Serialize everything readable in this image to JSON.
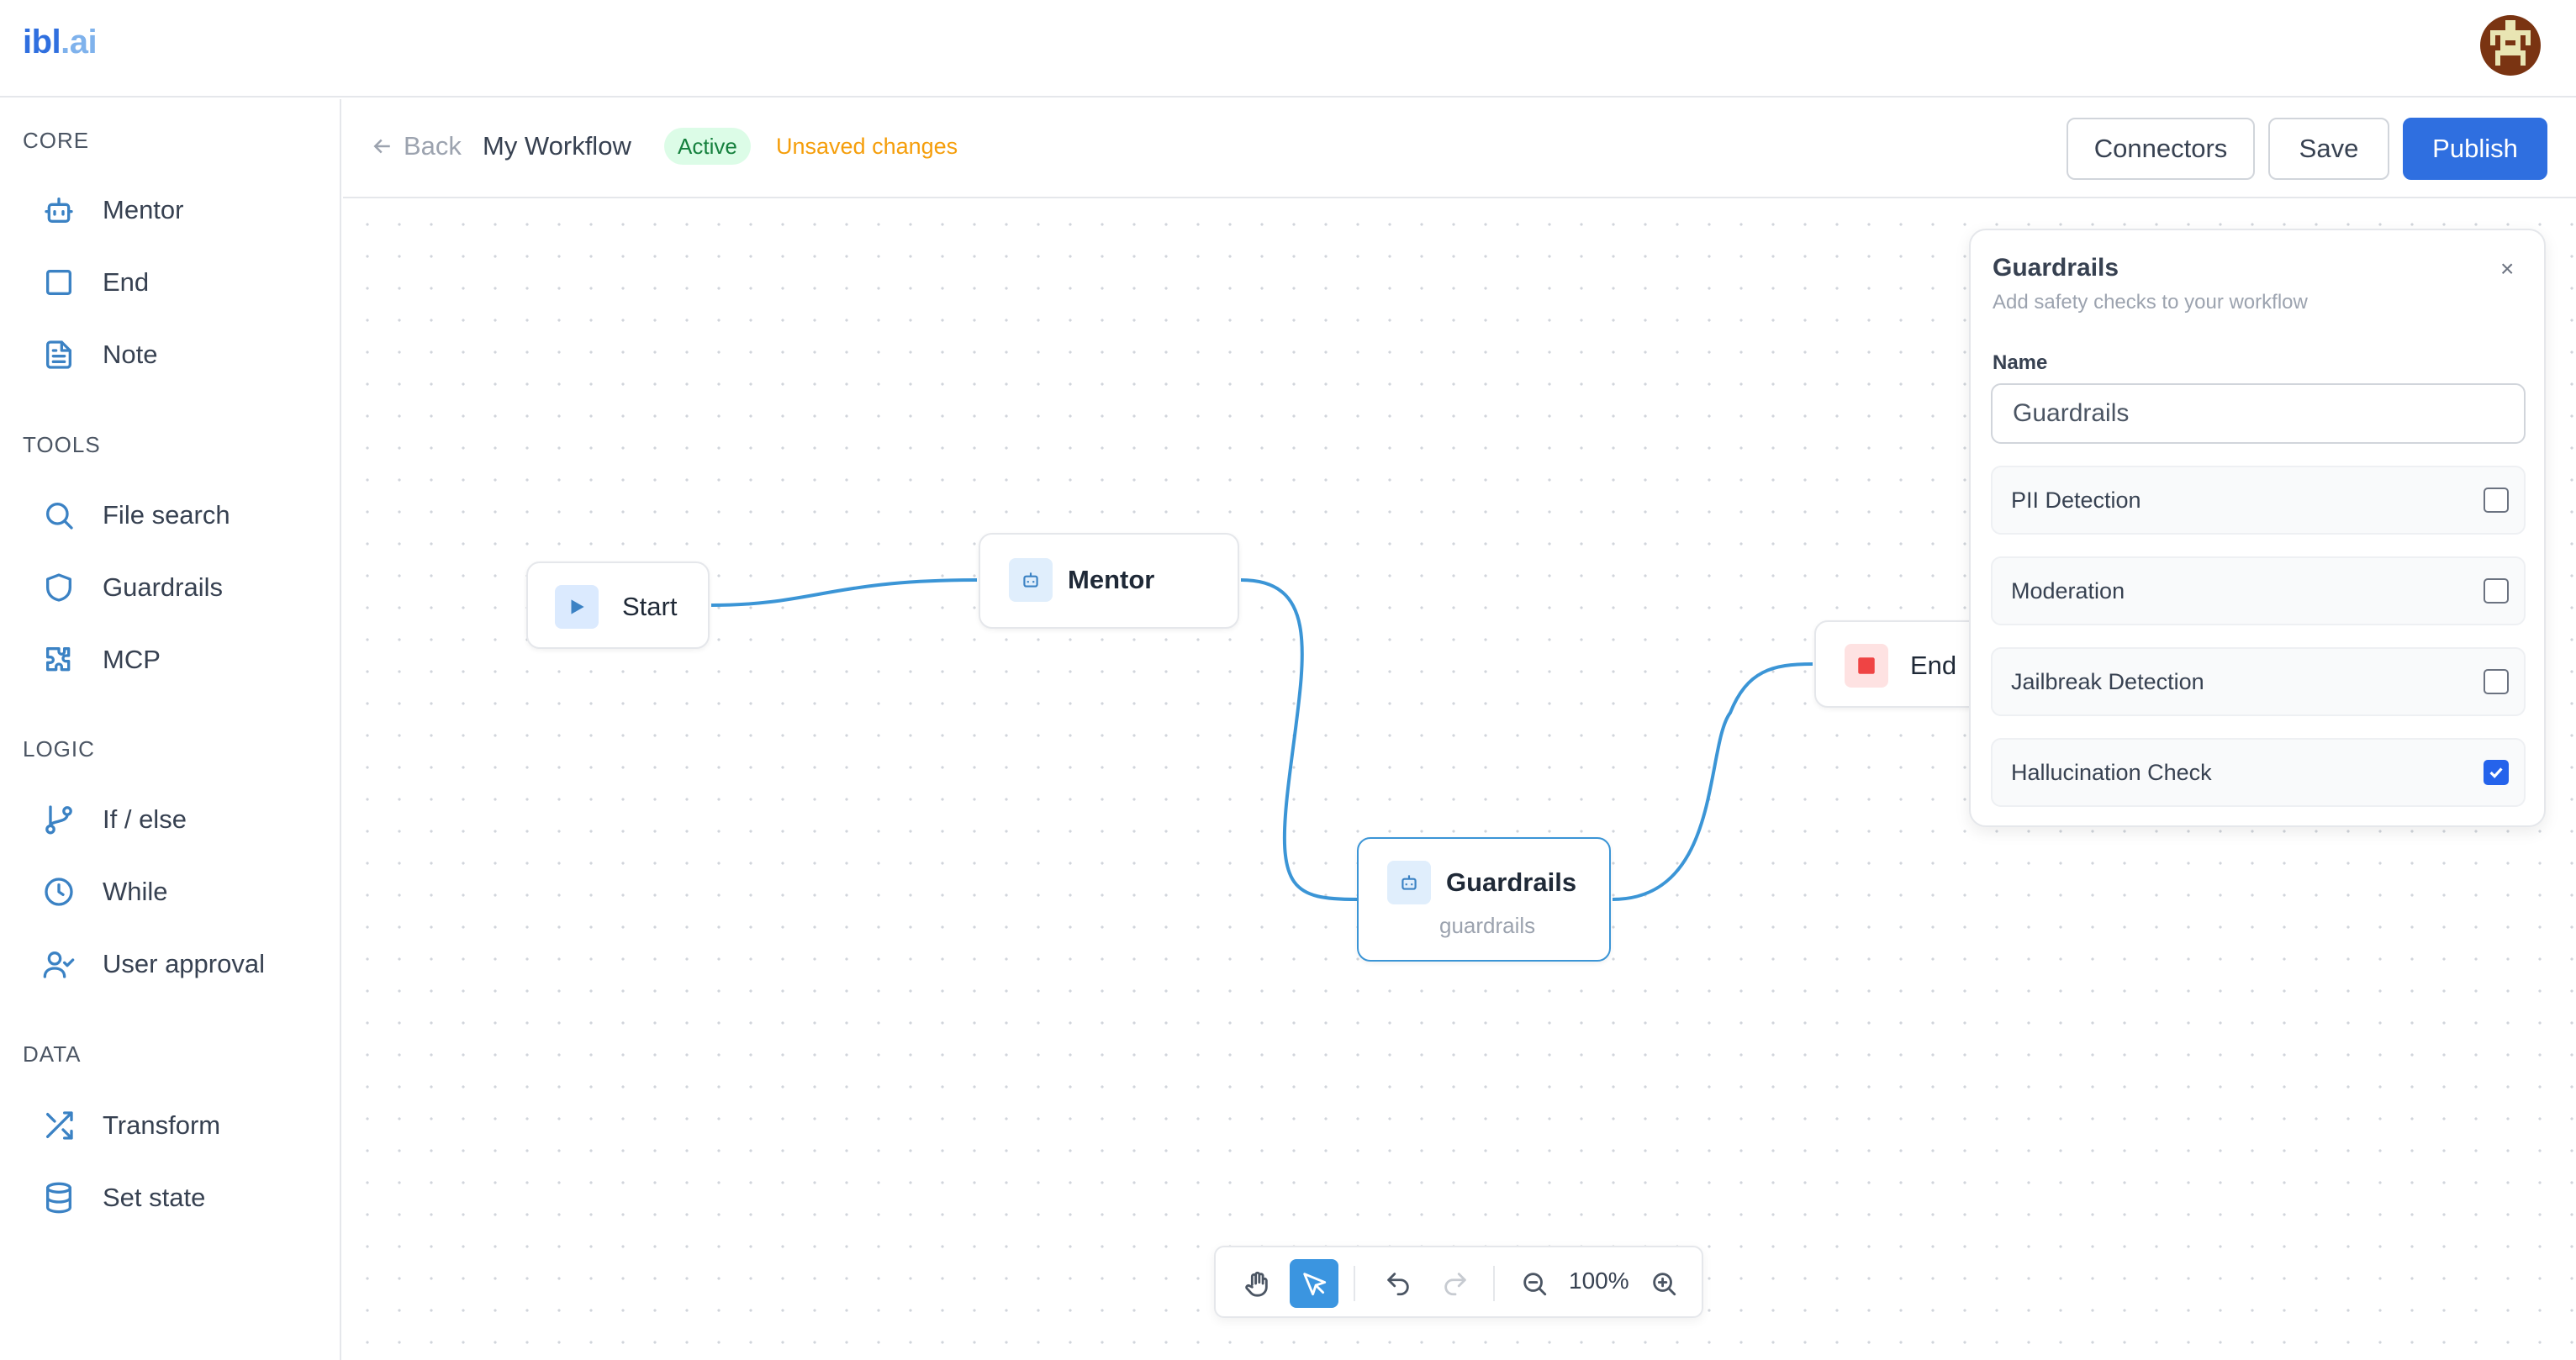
{
  "header": {
    "logo_part1": "ibl",
    "logo_part2": ".ai"
  },
  "sidebar": {
    "sections": [
      {
        "title": "CORE",
        "items": [
          {
            "label": "Mentor",
            "icon": "bot-icon"
          },
          {
            "label": "End",
            "icon": "square-icon"
          },
          {
            "label": "Note",
            "icon": "file-text-icon"
          }
        ]
      },
      {
        "title": "TOOLS",
        "items": [
          {
            "label": "File search",
            "icon": "search-icon"
          },
          {
            "label": "Guardrails",
            "icon": "shield-icon"
          },
          {
            "label": "MCP",
            "icon": "puzzle-icon"
          }
        ]
      },
      {
        "title": "LOGIC",
        "items": [
          {
            "label": "If / else",
            "icon": "git-branch-icon"
          },
          {
            "label": "While",
            "icon": "clock-icon"
          },
          {
            "label": "User approval",
            "icon": "user-check-icon"
          }
        ]
      },
      {
        "title": "DATA",
        "items": [
          {
            "label": "Transform",
            "icon": "shuffle-icon"
          },
          {
            "label": "Set state",
            "icon": "database-icon"
          }
        ]
      }
    ]
  },
  "workflow": {
    "back_label": "Back",
    "title": "My Workflow",
    "status_badge": "Active",
    "unsaved_label": "Unsaved changes",
    "connectors_label": "Connectors",
    "save_label": "Save",
    "publish_label": "Publish"
  },
  "canvas": {
    "nodes": {
      "start": {
        "label": "Start",
        "icon": "play-icon"
      },
      "mentor": {
        "label": "Mentor",
        "icon": "bot-icon"
      },
      "guardrails": {
        "label": "Guardrails",
        "sublabel": "guardrails",
        "icon": "bot-icon"
      },
      "end": {
        "label": "End",
        "icon": "stop-icon"
      }
    }
  },
  "panel": {
    "title": "Guardrails",
    "subtitle": "Add safety checks to your workflow",
    "close_label": "×",
    "name_label": "Name",
    "name_value": "Guardrails",
    "checks": [
      {
        "label": "PII Detection",
        "checked": false
      },
      {
        "label": "Moderation",
        "checked": false
      },
      {
        "label": "Jailbreak Detection",
        "checked": false
      },
      {
        "label": "Hallucination Check",
        "checked": true
      }
    ]
  },
  "toolbar": {
    "zoom_level": "100%"
  },
  "colors": {
    "accent": "#2f6fe0",
    "edge": "#3b95d6",
    "active_badge_bg": "#dcfce7",
    "active_badge_text": "#15803d",
    "unsaved": "#f59e0b",
    "end_node": "#ef4444"
  }
}
